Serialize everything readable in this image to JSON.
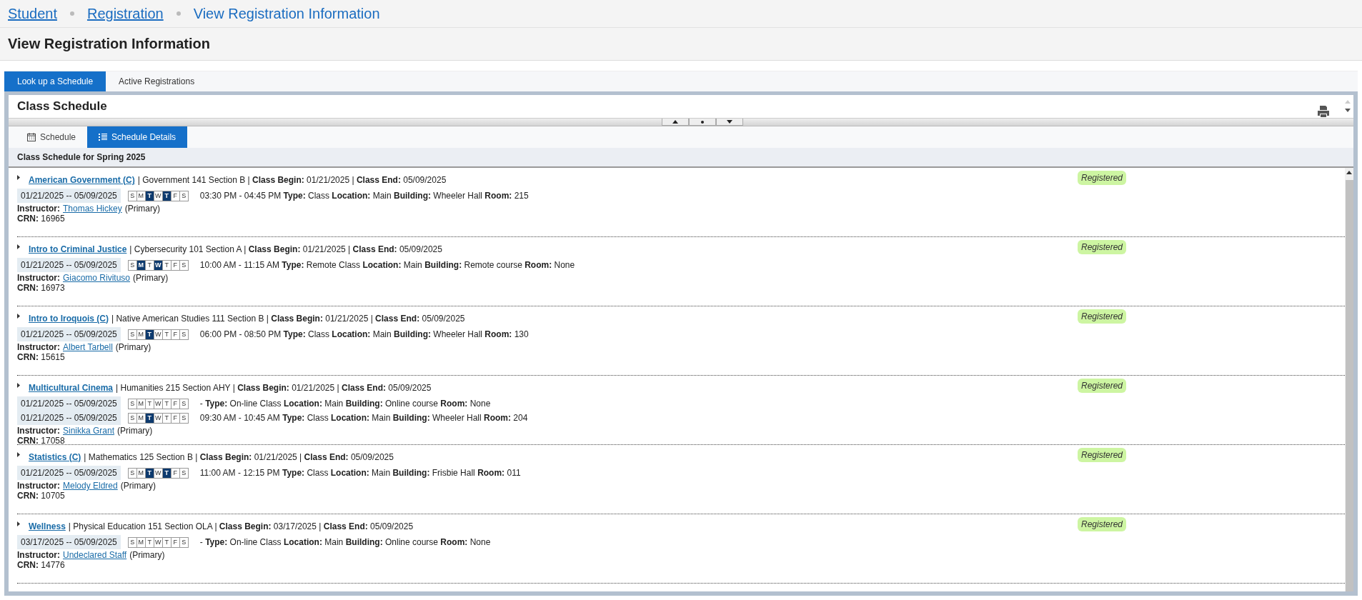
{
  "breadcrumbs": [
    {
      "label": "Student",
      "link": true
    },
    {
      "label": "Registration",
      "link": true
    },
    {
      "label": "View Registration Information",
      "link": false
    }
  ],
  "page_title": "View Registration Information",
  "tabs": [
    {
      "label": "Look up a Schedule",
      "selected": true
    },
    {
      "label": "Active Registrations",
      "selected": false
    }
  ],
  "panel": {
    "title": "Class Schedule",
    "view_tabs": [
      {
        "label": "Schedule",
        "kind": "calendar",
        "selected": false
      },
      {
        "label": "Schedule Details",
        "kind": "list",
        "selected": true
      }
    ],
    "heading": "Class Schedule for Spring 2025",
    "classes": [
      {
        "title": "American Government (C)",
        "summary": "| Government 141 Section B | **Class Begin:** 01/21/2025 | **Class End:** 05/09/2025",
        "status": "Registered",
        "meetings": [
          {
            "dates": "01/21/2025 -- 05/09/2025",
            "days": [
              {
                "letter": "S",
                "selected": false
              },
              {
                "letter": "M",
                "selected": false
              },
              {
                "letter": "T",
                "selected": true
              },
              {
                "letter": "W",
                "selected": false
              },
              {
                "letter": "T",
                "selected": true
              },
              {
                "letter": "F",
                "selected": false
              },
              {
                "letter": "S",
                "selected": false
              }
            ],
            "details": "03:30 PM - 04:45 PM **Type:** Class **Location:** Main **Building:** Wheeler Hall **Room:** 215"
          }
        ],
        "instructor_label": "Instructor:",
        "instructor": "Thomas Hickey",
        "instructor_role": "(Primary)",
        "crn": "**CRN:** 16965"
      },
      {
        "title": "Intro to Criminal Justice",
        "summary": "| Cybersecurity 101 Section A | **Class Begin:** 01/21/2025 | **Class End:** 05/09/2025",
        "status": "Registered",
        "meetings": [
          {
            "dates": "01/21/2025 -- 05/09/2025",
            "days": [
              {
                "letter": "S",
                "selected": false
              },
              {
                "letter": "M",
                "selected": true
              },
              {
                "letter": "T",
                "selected": false
              },
              {
                "letter": "W",
                "selected": true
              },
              {
                "letter": "T",
                "selected": false
              },
              {
                "letter": "F",
                "selected": false
              },
              {
                "letter": "S",
                "selected": false
              }
            ],
            "details": "10:00 AM - 11:15 AM **Type:** Remote Class **Location:** Main **Building:** Remote course **Room:** None"
          }
        ],
        "instructor_label": "Instructor:",
        "instructor": "Giacomo Rivituso",
        "instructor_role": "(Primary)",
        "crn": "**CRN:** 16973"
      },
      {
        "title": "Intro to Iroquois (C)",
        "summary": "| Native American Studies 111 Section B | **Class Begin:** 01/21/2025 | **Class End:** 05/09/2025",
        "status": "Registered",
        "meetings": [
          {
            "dates": "01/21/2025 -- 05/09/2025",
            "days": [
              {
                "letter": "S",
                "selected": false
              },
              {
                "letter": "M",
                "selected": false
              },
              {
                "letter": "T",
                "selected": true
              },
              {
                "letter": "W",
                "selected": false
              },
              {
                "letter": "T",
                "selected": false
              },
              {
                "letter": "F",
                "selected": false
              },
              {
                "letter": "S",
                "selected": false
              }
            ],
            "details": "06:00 PM - 08:50 PM **Type:** Class **Location:** Main **Building:** Wheeler Hall **Room:** 130"
          }
        ],
        "instructor_label": "Instructor:",
        "instructor": "Albert Tarbell",
        "instructor_role": "(Primary)",
        "crn": "**CRN:** 15615"
      },
      {
        "title": "Multicultural Cinema",
        "summary": "| Humanities 215 Section AHY | **Class Begin:** 01/21/2025 | **Class End:** 05/09/2025",
        "status": "Registered",
        "meetings": [
          {
            "dates": "01/21/2025 -- 05/09/2025",
            "days": [
              {
                "letter": "S",
                "selected": false
              },
              {
                "letter": "M",
                "selected": false
              },
              {
                "letter": "T",
                "selected": false
              },
              {
                "letter": "W",
                "selected": false
              },
              {
                "letter": "T",
                "selected": false
              },
              {
                "letter": "F",
                "selected": false
              },
              {
                "letter": "S",
                "selected": false
              }
            ],
            "details": "- **Type:** On-line Class **Location:** Main **Building:** Online course **Room:** None"
          },
          {
            "dates": "01/21/2025 -- 05/09/2025",
            "days": [
              {
                "letter": "S",
                "selected": false
              },
              {
                "letter": "M",
                "selected": false
              },
              {
                "letter": "T",
                "selected": true
              },
              {
                "letter": "W",
                "selected": false
              },
              {
                "letter": "T",
                "selected": false
              },
              {
                "letter": "F",
                "selected": false
              },
              {
                "letter": "S",
                "selected": false
              }
            ],
            "details": "09:30 AM - 10:45 AM **Type:** Class **Location:** Main **Building:** Wheeler Hall **Room:** 204"
          }
        ],
        "instructor_label": "Instructor:",
        "instructor": "Sinikka Grant",
        "instructor_role": "(Primary)",
        "crn": "**CRN:** 17058"
      },
      {
        "title": "Statistics (C)",
        "summary": "| Mathematics 125 Section B | **Class Begin:** 01/21/2025 | **Class End:** 05/09/2025",
        "status": "Registered",
        "meetings": [
          {
            "dates": "01/21/2025 -- 05/09/2025",
            "days": [
              {
                "letter": "S",
                "selected": false
              },
              {
                "letter": "M",
                "selected": false
              },
              {
                "letter": "T",
                "selected": true
              },
              {
                "letter": "W",
                "selected": false
              },
              {
                "letter": "T",
                "selected": true
              },
              {
                "letter": "F",
                "selected": false
              },
              {
                "letter": "S",
                "selected": false
              }
            ],
            "details": "11:00 AM - 12:15 PM **Type:** Class **Location:** Main **Building:** Frisbie Hall **Room:** 011"
          }
        ],
        "instructor_label": "Instructor:",
        "instructor": "Melody Eldred",
        "instructor_role": "(Primary)",
        "crn": "**CRN:** 10705"
      },
      {
        "title": "Wellness",
        "summary": "| Physical Education 151 Section OLA | **Class Begin:** 03/17/2025 | **Class End:** 05/09/2025",
        "status": "Registered",
        "meetings": [
          {
            "dates": "03/17/2025 -- 05/09/2025",
            "days": [
              {
                "letter": "S",
                "selected": false
              },
              {
                "letter": "M",
                "selected": false
              },
              {
                "letter": "T",
                "selected": false
              },
              {
                "letter": "W",
                "selected": false
              },
              {
                "letter": "T",
                "selected": false
              },
              {
                "letter": "F",
                "selected": false
              },
              {
                "letter": "S",
                "selected": false
              }
            ],
            "details": "- **Type:** On-line Class **Location:** Main **Building:** Online course **Room:** None"
          }
        ],
        "instructor_label": "Instructor:",
        "instructor": "Undeclared Staff",
        "instructor_role": "(Primary)",
        "crn": "**CRN:** 14776"
      }
    ]
  }
}
